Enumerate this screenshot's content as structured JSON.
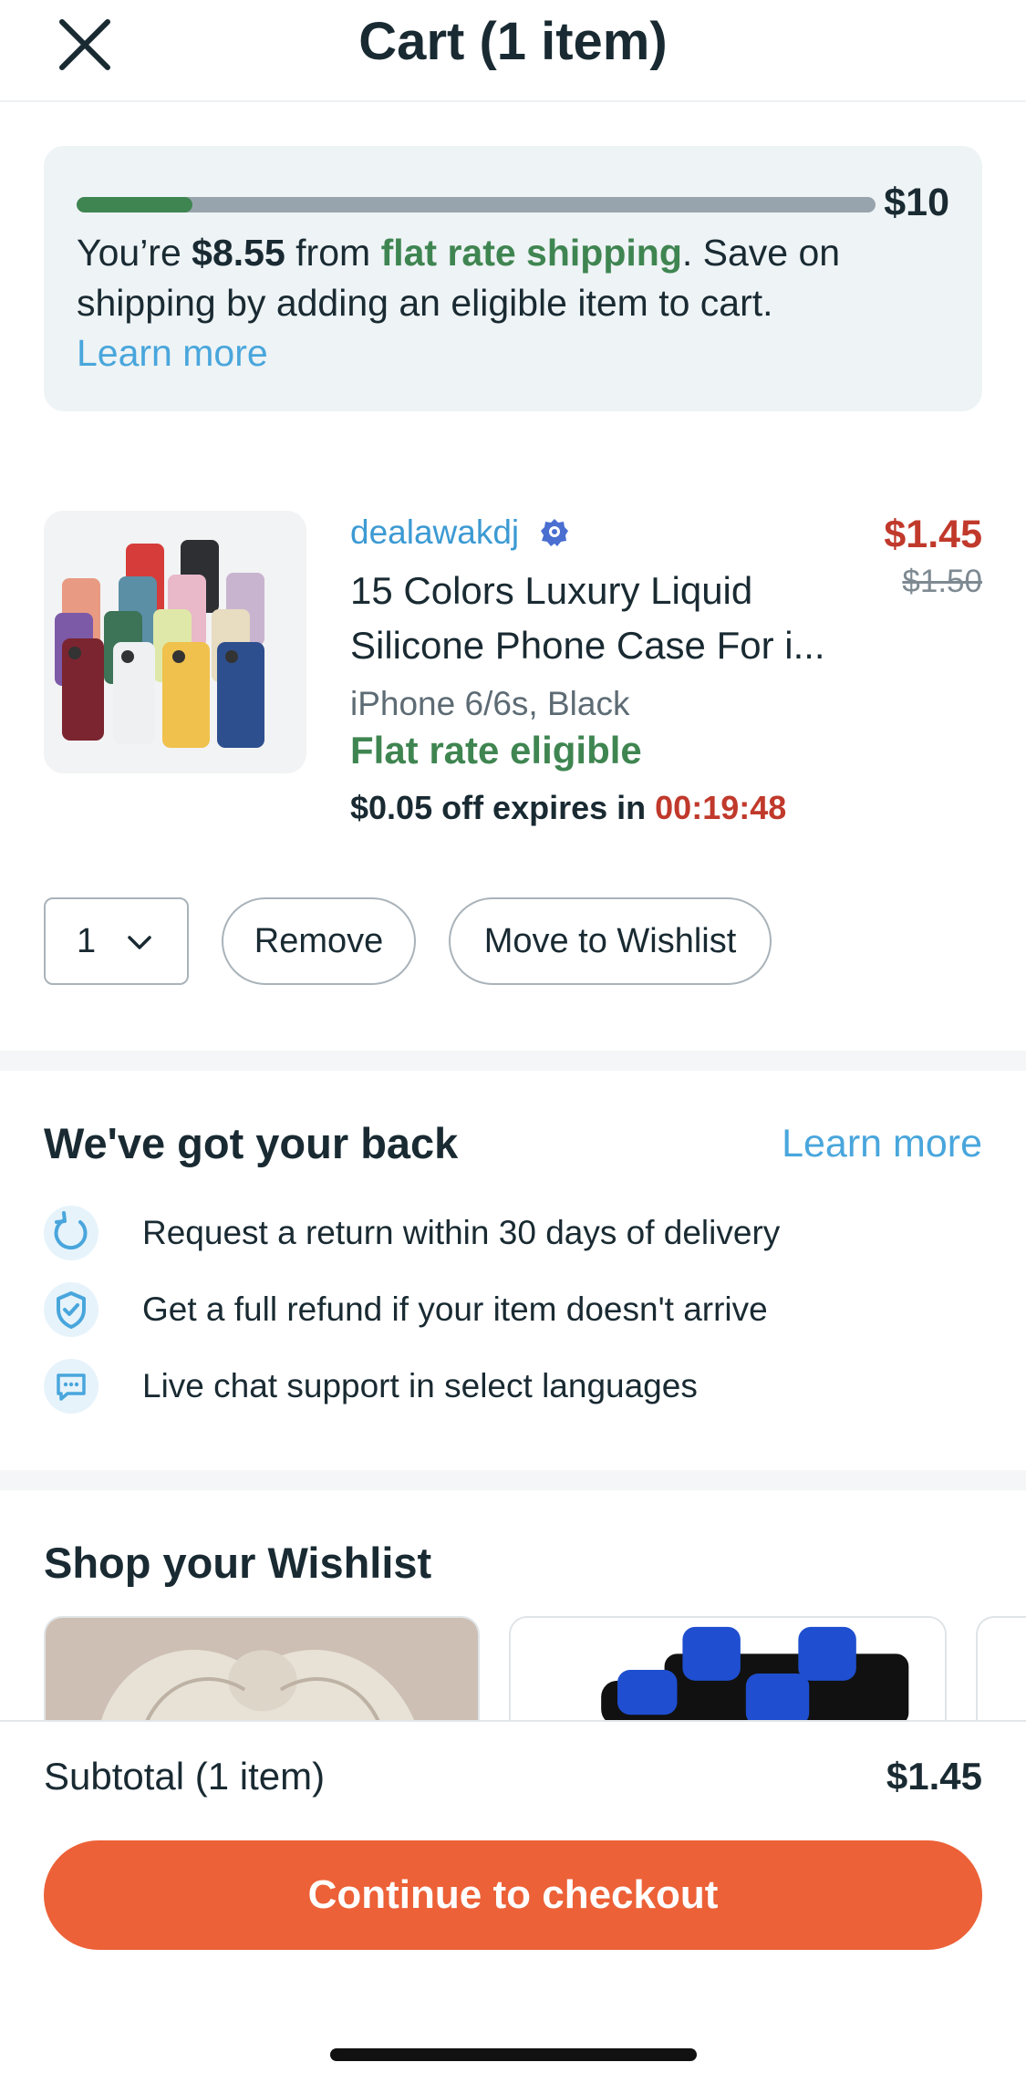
{
  "header": {
    "title": "Cart (1 item)",
    "close_icon": "close-icon"
  },
  "shipping": {
    "progress_fraction": 0.145,
    "goal": "$10",
    "text_prefix": "You’re ",
    "amount": "$8.55",
    "text_mid": " from ",
    "highlight": "flat rate shipping",
    "text_suffix": ". Save on shipping by adding an eligible item to cart.",
    "learn_more": "Learn more",
    "colors": {
      "progress": "#3f8551",
      "track": "#98a4ad",
      "card": "#eef3f5"
    }
  },
  "item": {
    "seller": "dealawakdj",
    "seller_badge_icon": "verified-badge-icon",
    "title_line1": "15 Colors Luxury Liquid",
    "title_line2": "Silicone Phone Case For i...",
    "variant": "iPhone 6/6s, Black",
    "flat_rate": "Flat rate eligible",
    "price": "$1.45",
    "original_price": "$1.50",
    "discount_text": "$0.05 off expires in ",
    "timer": "00:19:48",
    "quantity": "1",
    "remove_label": "Remove",
    "wishlist_label": "Move to Wishlist",
    "colors": {
      "price": "#c0392b",
      "flat": "#3f8551",
      "seller": "#3c9ad3"
    }
  },
  "guarantees": {
    "title": "We've got your back",
    "learn_more": "Learn more",
    "items": [
      {
        "icon": "return-icon",
        "text": "Request a return within 30 days of delivery"
      },
      {
        "icon": "shield-check-icon",
        "text": "Get a full refund if your item doesn't arrive"
      },
      {
        "icon": "chat-icon",
        "text": "Live chat support in select languages"
      }
    ]
  },
  "wishlist": {
    "title": "Shop your Wishlist"
  },
  "footer": {
    "subtotal_label": "Subtotal (1 item)",
    "subtotal_value": "$1.45",
    "checkout_label": "Continue to checkout",
    "colors": {
      "checkout": "#ec6137"
    }
  }
}
